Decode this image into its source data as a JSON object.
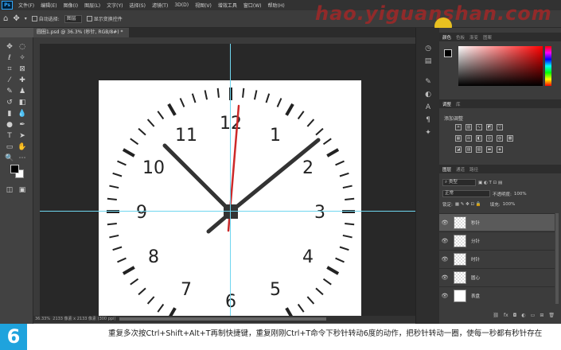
{
  "app": {
    "logo": "Ps",
    "menu": [
      "文件(F)",
      "编辑(E)",
      "图像(I)",
      "图层(L)",
      "文字(Y)",
      "选择(S)",
      "滤镜(T)",
      "3D(D)",
      "视图(V)",
      "增效工具",
      "窗口(W)",
      "帮助(H)"
    ]
  },
  "watermark": "hao.yiguanshan.com",
  "options": {
    "auto_select_label": "自动选择:",
    "auto_select_value": "图层",
    "show_transform_label": "显示变换控件"
  },
  "document": {
    "tab_title": "圆圈1.psd @ 36.3% (秒针, RGB/8#) *",
    "zoom": "36.33%",
    "status": "2133 像素 x 2133 像素 (300 ppi)"
  },
  "clock": {
    "numbers": [
      "12",
      "1",
      "2",
      "3",
      "4",
      "5",
      "6",
      "7",
      "8",
      "9",
      "10",
      "11"
    ]
  },
  "panels": {
    "color_tabs": [
      "颜色",
      "色板",
      "渐变",
      "图案"
    ],
    "adjust_tabs": [
      "调整",
      "库"
    ],
    "adjust_title": "添加调整",
    "layer_tabs": [
      "图层",
      "通道",
      "路径"
    ],
    "filter_kind": "类型",
    "blend_mode": "正常",
    "opacity_label": "不透明度:",
    "opacity_value": "100%",
    "lock_label": "锁定:",
    "fill_label": "填充:",
    "fill_value": "100%",
    "layers": [
      {
        "name": "秒针",
        "selected": true
      },
      {
        "name": "分针",
        "selected": false
      },
      {
        "name": "时针",
        "selected": false
      },
      {
        "name": "圆心",
        "selected": false
      },
      {
        "name": "表盘",
        "selected": false
      }
    ]
  },
  "caption": {
    "step": "6",
    "text": "重复多次按Ctrl+Shift+Alt+T再制快捷键，重复刚刚Ctrl+T命令下秒针转动6度的动作，把秒针转动一圈，使每一秒都有秒针存在"
  }
}
